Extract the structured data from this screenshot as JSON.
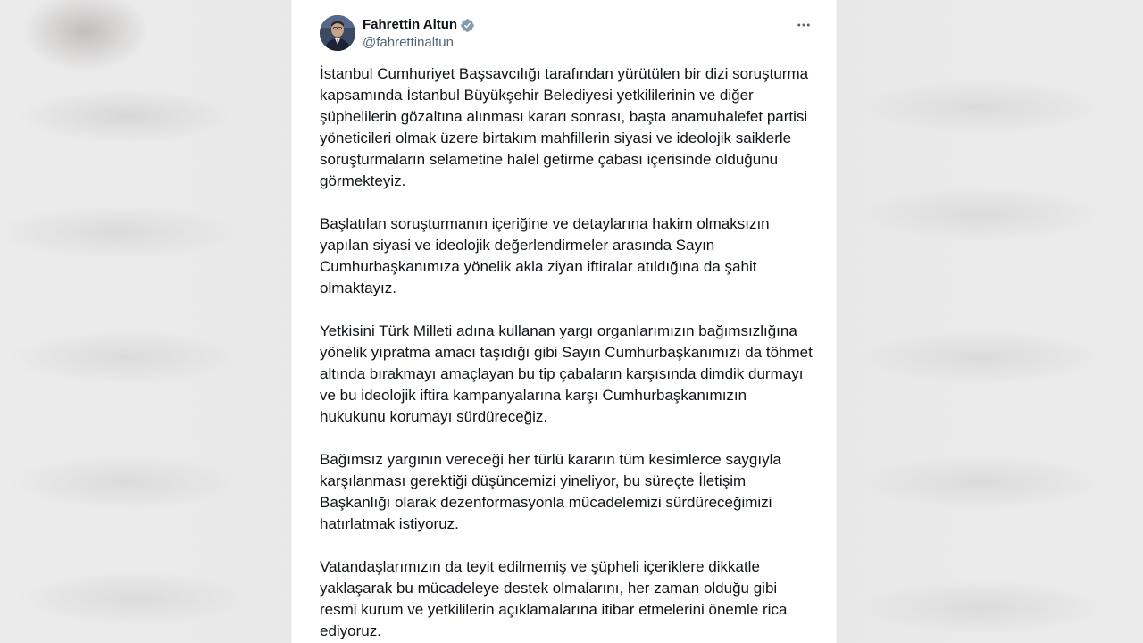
{
  "tweet": {
    "author_name": "Fahrettin Altun",
    "author_handle": "@fahrettinaltun",
    "verified_icon": "verified-badge-icon",
    "more_icon": "more-options-icon",
    "colors": {
      "verified": "#829aab",
      "text": "#0f1419",
      "secondary": "#536471"
    },
    "paragraphs": [
      {
        "lines": [
          "İstanbul Cumhuriyet Başsavcılığı tarafından yürütülen bir dizi soruşturma",
          "kapsamında İstanbul Büyükşehir Belediyesi yetkililerinin ve diğer",
          "şüphelilerin gözaltına alınması kararı sonrası, başta anamuhalefet partisi",
          "yöneticileri olmak üzere birtakım mahfillerin siyasi ve ideolojik saiklerle",
          "soruşturmaların selametine halel getirme çabası içerisinde olduğunu",
          "görmekteyiz."
        ]
      },
      {
        "lines": [
          "Başlatılan soruşturmanın içeriğine ve detaylarına hakim olmaksızın",
          "yapılan siyasi ve ideolojik değerlendirmeler arasında Sayın",
          "Cumhurbaşkanımıza yönelik akla ziyan iftiralar atıldığına da şahit",
          "olmaktayız."
        ]
      },
      {
        "lines": [
          "Yetkisini Türk Milleti adına kullanan yargı organlarımızın bağımsızlığına",
          "yönelik yıpratma amacı taşıdığı gibi Sayın Cumhurbaşkanımızı da töhmet",
          "altında bırakmayı amaçlayan bu tip çabaların karşısında dimdik durmayı",
          "ve bu ideolojik iftira kampanyalarına karşı Cumhurbaşkanımızın",
          "hukukunu korumayı sürdüreceğiz."
        ]
      },
      {
        "lines": [
          "Bağımsız yargının vereceği her türlü kararın tüm kesimlerce saygıyla",
          "karşılanması gerektiği düşüncemizi yineliyor, bu süreçte İletişim",
          "Başkanlığı olarak dezenformasyonla mücadelemizi sürdüreceğimizi",
          "hatırlatmak istiyoruz."
        ]
      },
      {
        "lines": [
          "Vatandaşlarımızın da teyit edilmemiş ve şüpheli içeriklere dikkatle",
          "yaklaşarak bu mücadeleye destek olmalarını, her zaman olduğu gibi",
          "resmi kurum ve yetkililerin açıklamalarına itibar etmelerini önemle rica",
          "ediyoruz."
        ]
      }
    ]
  }
}
